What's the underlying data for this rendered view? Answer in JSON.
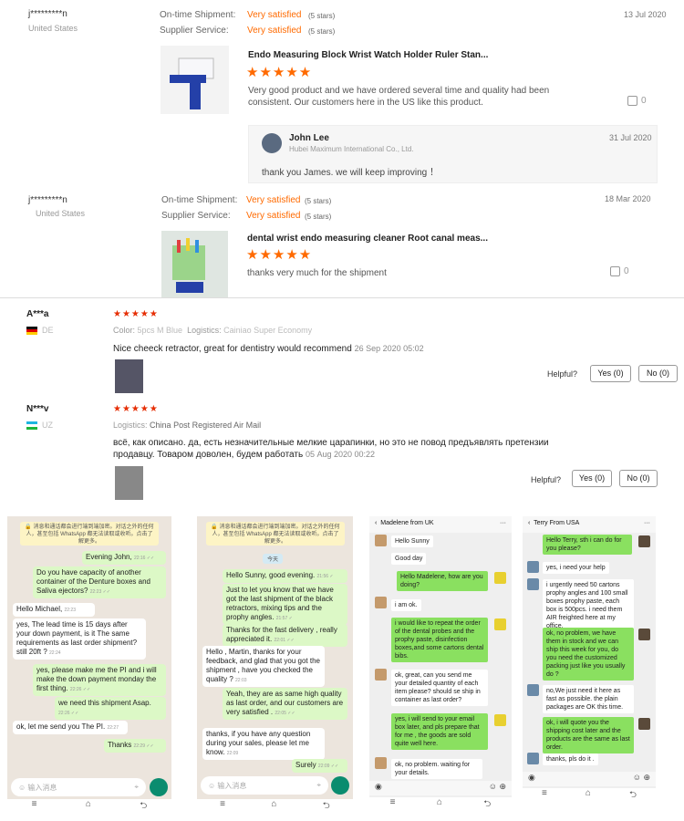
{
  "reviews": [
    {
      "buyer": "j*********n",
      "country": "United States",
      "shipment_label": "On-time Shipment:",
      "shipment_value": "Very satisfied",
      "shipment_stars": "(5 stars)",
      "supplier_label": "Supplier Service:",
      "supplier_value": "Very satisfied",
      "supplier_stars": "(5 stars)",
      "date": "13 Jul 2020",
      "product": "Endo Measuring Block Wrist Watch Holder Ruler Stan...",
      "stars": "★★★★★",
      "text": "Very good product and we have ordered several time and quality had been consistent.  Our customers here in the US like this product.",
      "likes": "0",
      "reply": {
        "name": "John Lee",
        "company": "Hubei Maximum International Co., Ltd.",
        "date": "31 Jul 2020",
        "text": "thank you James. we will keep improving ！"
      }
    },
    {
      "buyer": "j*********n",
      "country": "United States",
      "shipment_label": "On-time Shipment:",
      "shipment_value": "Very satisfied",
      "shipment_stars": "(5 stars)",
      "supplier_label": "Supplier Service:",
      "supplier_value": "Very satisfied",
      "supplier_stars": "(5 stars)",
      "date": "18 Mar 2020",
      "product": "dental wrist endo measuring cleaner Root canal meas...",
      "stars": "★★★★★",
      "text": "thanks very much for the shipment",
      "likes": "0"
    }
  ],
  "ae_reviews": [
    {
      "name": "A***a",
      "country": "DE",
      "stars": "★★★★★",
      "color_label": "Color:",
      "color_value": "5pcs M Blue",
      "logistics_label": "Logistics:",
      "logistics_value": "Cainiao Super Economy",
      "text": "Nice cheeck retractor, great for dentistry would recommend",
      "date": "26 Sep 2020 05:02",
      "helpful": "Helpful?",
      "yes": "Yes (0)",
      "no": "No (0)"
    },
    {
      "name": "N***v",
      "country": "UZ",
      "stars": "★★★★★",
      "logistics_label": "Logistics:",
      "logistics_value": "China Post Registered Air Mail",
      "text1": "всё, как описано. да, есть незначительные мелкие царапинки, но это не повод предъявлять претензии",
      "text2": "продавцу. Товаром доволен, будем работать",
      "date": "05 Aug 2020 00:22",
      "helpful": "Helpful?",
      "yes": "Yes (0)",
      "no": "No (0)"
    }
  ],
  "chat1": {
    "banner": "🔒 消息和通话都会进行端到端加密。对话之外的任何人，甚至包括 WhatsApp 都无法读取或收听。点击了解更多。",
    "messages": [
      {
        "text": "Evening John,",
        "time": "22:16 ✓✓"
      },
      {
        "text": "Do you have capacity of another container of the Denture boxes and Saliva ejectors?",
        "time": "22:23 ✓✓"
      },
      {
        "text": "Hello Michael,",
        "time": "22:23"
      },
      {
        "text": "yes, The lead time is 15 days after your down payment, is it The same requirements as last order shipment? still 20ft ?",
        "time": "22:24"
      },
      {
        "text": "yes, please make me the PI and i will make the down payment monday the first thing.",
        "time": "22:26 ✓✓"
      },
      {
        "text": "we need this shipment Asap.",
        "time": "22:26 ✓✓"
      },
      {
        "text": "ok, let me send you The PI.",
        "time": "22:27"
      },
      {
        "text": "Thanks",
        "time": "22:29 ✓✓"
      }
    ],
    "input_placeholder": "输入消息"
  },
  "chat2": {
    "banner": "🔒 消息和通话都会进行端到端加密。对话之外的任何人，甚至包括 WhatsApp 都无法读取或收听。点击了解更多。",
    "day": "今天",
    "messages": [
      {
        "text": "Hello Sunny, good evening.",
        "time": "21:56 ✓"
      },
      {
        "text": "Just to let you know that we have got the last shipment of the black retractors, mixing tips and the prophy angles.",
        "time": "21:57 ✓"
      },
      {
        "text": "Thanks for the fast delivery , really appreciated it.",
        "time": "22:01 ✓✓"
      },
      {
        "text": "Hello , Martin, thanks for your feedback, and glad that you got the shipment , have you checked the quality ?",
        "time": "22:03"
      },
      {
        "text": "Yeah, they are as same high quality as last order, and our customers are very satisfied .",
        "time": "22:05 ✓✓"
      },
      {
        "text": "thanks, if you have any  question during your sales, please let me know.",
        "time": "22:09"
      },
      {
        "text": "Surely",
        "time": "22:09 ✓✓"
      }
    ],
    "input_placeholder": "输入消息"
  },
  "chat3": {
    "title": "Madelene from UK",
    "messages": [
      "Hello Sunny",
      "Good day",
      "Hello Madelene, how are you doing?",
      "i am ok.",
      "i would like to repeat the order of the dental probes and the prophy paste, disinfection boxes,and some cartons dental bibs.",
      "ok, great, can you send me your detailed quantity of each item please? should se ship in container as last order?",
      "yes, i will send to your email box later, and pls prepare that for me , the goods are sold quite well here.",
      "ok, no problem. waiting for your details."
    ]
  },
  "chat4": {
    "title": "Terry From USA",
    "messages": [
      "Hello Terry, sth i can do for you please?",
      "yes, i need your help",
      "i urgently need 50 cartons prophy angles  and 100 small boxes prophy paste, each box is 500pcs.  i need them AIR freighted here at my office.",
      "ok, no problem, we have them in stock and we can ship this week for you, do you need the customized packing just like you usually do ?",
      "no,We just need it here as fast as possible. the plain packages are OK this time.",
      "ok, i will quote you the shipping cost later and the products are the same as last order.",
      "thanks, pls do it ."
    ]
  },
  "nav": {
    "menu": "≡",
    "home": "⌂",
    "back": "⮌"
  },
  "colors": {
    "accent": "#ff6a00",
    "wa_green": "#dcf8c6",
    "wechat_green": "#8ae060"
  }
}
